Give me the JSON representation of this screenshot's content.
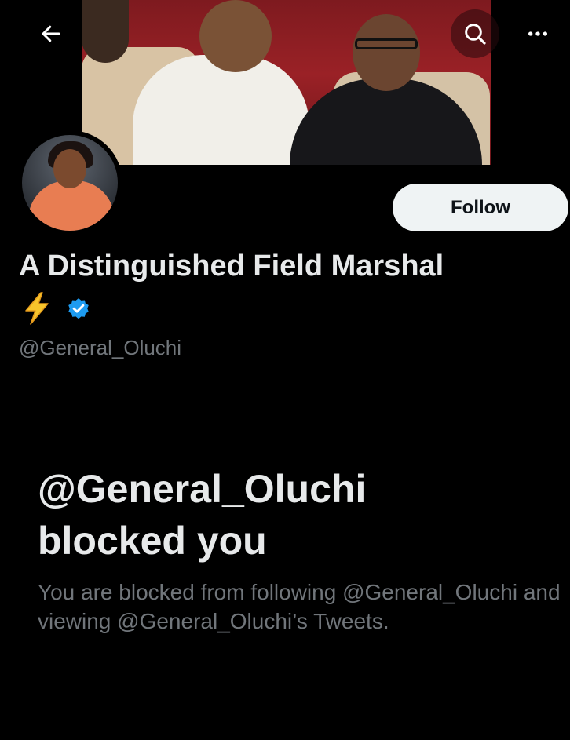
{
  "header": {
    "back_icon": "arrow-left-icon",
    "search_icon": "search-icon",
    "more_icon": "more-horizontal-icon"
  },
  "profile": {
    "display_name": "A Distinguished Field Marshal",
    "name_emoji": "⚡",
    "verified_icon": "verified-badge-icon",
    "handle": "@General_Oluchi",
    "follow_label": "Follow"
  },
  "blocked": {
    "title_line1": "@General_Oluchi",
    "title_line2": "blocked you",
    "description": "You are blocked from following @General_Oluchi and viewing @General_Oluchi’s Tweets."
  },
  "colors": {
    "background": "#000000",
    "text_primary": "#e7e9ea",
    "text_secondary": "#71767b",
    "verified_blue": "#1d9bf0",
    "follow_button_bg": "#eff3f4"
  }
}
